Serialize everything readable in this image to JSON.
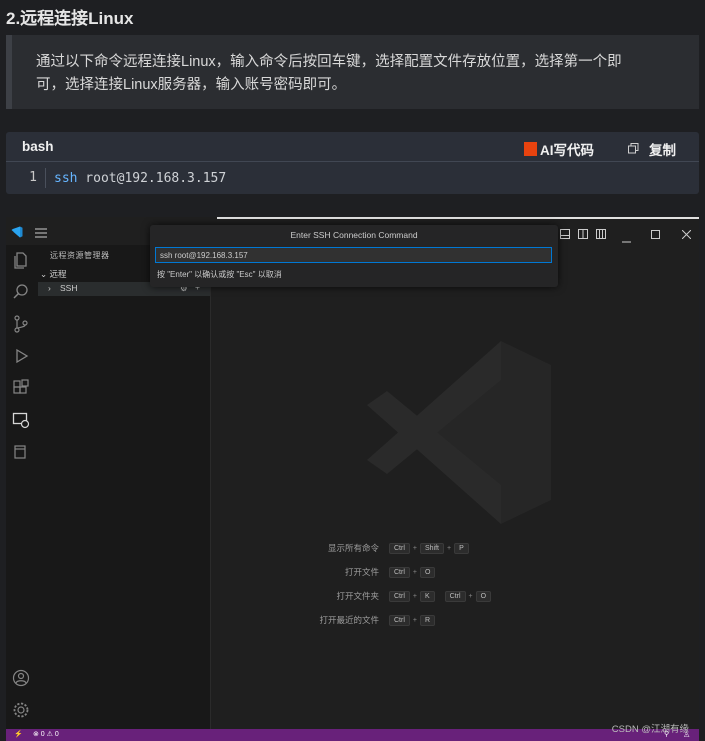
{
  "article": {
    "heading": "2.远程连接Linux",
    "paragraph_line1": "通过以下命令远程连接Linux，输入命令后按回车键，选择配置文件存放位置，选择第一个即",
    "paragraph_line2": "可，选择连接Linux服务器，输入账号密码即可。"
  },
  "codeblock": {
    "language": "bash",
    "ai_label": "AI写代码",
    "copy_label": "复制",
    "line_number": "1",
    "command_keyword": "ssh",
    "command_rest": " root@192.168.3.157"
  },
  "vscode": {
    "sidebar": {
      "title": "远程资源管理器",
      "section": "远程",
      "item": "SSH"
    },
    "quickpick": {
      "title": "Enter SSH Connection Command",
      "input_value": "ssh root@192.168.3.157",
      "hint": "按 \"Enter\" 以确认或按 \"Esc\" 以取消"
    },
    "shortcuts": [
      {
        "label": "显示所有命令",
        "keys": [
          "Ctrl",
          "Shift",
          "P"
        ]
      },
      {
        "label": "打开文件",
        "keys": [
          "Ctrl",
          "O"
        ]
      },
      {
        "label": "打开文件夹",
        "keys": [
          "Ctrl",
          "K",
          "Ctrl",
          "O"
        ]
      },
      {
        "label": "打开最近的文件",
        "keys": [
          "Ctrl",
          "R"
        ]
      }
    ],
    "status": {
      "problems": "⊗ 0 ⚠ 0"
    }
  },
  "watermark": "CSDN @江湖有缘",
  "colors": {
    "accent_blue": "#0078d4",
    "status_purple": "#68217a",
    "ai_orange": "#e8430f"
  }
}
